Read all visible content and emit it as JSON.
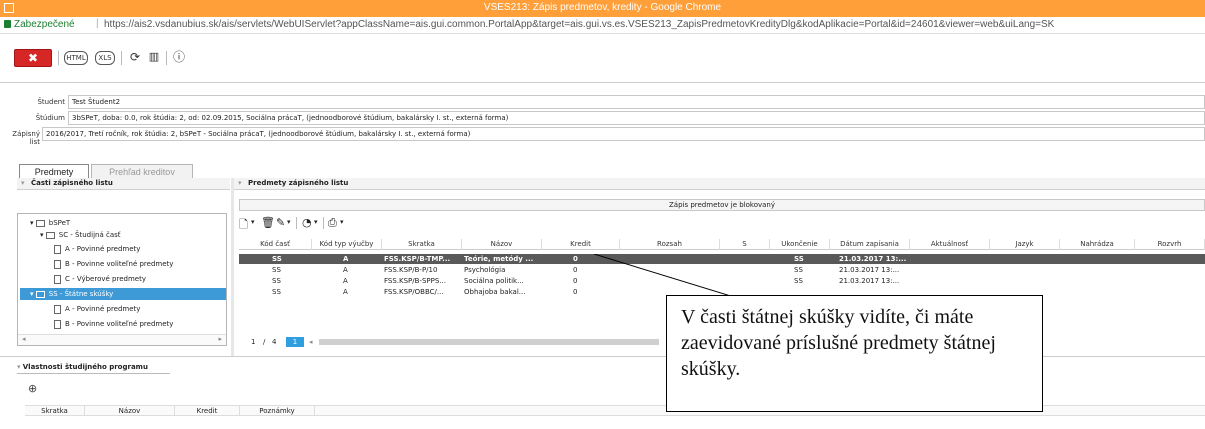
{
  "window": {
    "title": "VSES213: Zápis predmetov, kredity - Google Chrome"
  },
  "address": {
    "secure_label": "Zabezpečené",
    "separator": "|",
    "url": "https://ais2.vsdanubius.sk/ais/servlets/WebUIServlet?appClassName=ais.gui.common.PortalApp&target=ais.gui.vs.es.VSES213_ZapisPredmetovKredityDlg&kodAplikacie=Portal&id=24601&viewer=web&uiLang=SK"
  },
  "toolbar": {
    "close_label": "✖",
    "html_label": "HTML",
    "xls_label": "XLS",
    "info_label": "ⓘ"
  },
  "info": {
    "student_label": "Študent",
    "student_value": "Test Študent2",
    "study_label": "Štúdium",
    "study_value": "3bSPeT, doba: 0.0, rok štúdia: 2, od: 02.09.2015, Sociálna prácaT, (jednoodborové štúdium, bakalársky I. st., externá forma)",
    "enroll_label": "Zápisný list",
    "enroll_value": "2016/2017, Tretí ročník, rok štúdia: 2, bSPeT - Sociálna prácaT, (jednoodborové štúdium, bakalársky I. st., externá forma)"
  },
  "tabs": [
    {
      "label": "Predmety"
    },
    {
      "label": "Prehľad kreditov"
    }
  ],
  "left_panel": {
    "title": "Časti zápisného listu",
    "tree": [
      {
        "label": "bSPeT"
      },
      {
        "label": "SC - Študijná časť"
      },
      {
        "label": "A - Povinné predmety"
      },
      {
        "label": "B - Povinne voliteľné predmety"
      },
      {
        "label": "C - Výberové predmety"
      },
      {
        "label": "SS - Štátne skúšky"
      },
      {
        "label": "A - Povinné predmety"
      },
      {
        "label": "B - Povinne voliteľné predmety"
      }
    ]
  },
  "right_panel": {
    "title": "Predmety zápisného listu",
    "banner": "Zápis predmetov je blokovaný",
    "columns": [
      "Kód časť",
      "Kód typ výučby",
      "Skratka",
      "Názov",
      "Kredit",
      "Rozsah",
      "S",
      "Ukončenie",
      "Dátum zapísania",
      "Aktuálnosť",
      "Jazyk",
      "Nahrádza",
      "Rozvrh"
    ],
    "rows": [
      [
        "SS",
        "A",
        "FSS.KSP/B-TMP...",
        "Teórie, metódy ...",
        "0",
        "",
        "",
        "SS",
        "21.03.2017 13:...",
        "",
        "",
        "",
        ""
      ],
      [
        "SS",
        "A",
        "FSS.KSP/B-P/10",
        "Psychológia",
        "0",
        "",
        "",
        "SS",
        "21.03.2017 13:...",
        "",
        "",
        "",
        ""
      ],
      [
        "SS",
        "A",
        "FSS.KSP/B-SPPS...",
        "Sociálna politik...",
        "0",
        "",
        "",
        "SS",
        "21.03.2017 13:...",
        "",
        "",
        "",
        ""
      ],
      [
        "SS",
        "A",
        "FSS.KSP/OBBC/...",
        "Obhajoba bakal...",
        "0",
        "",
        "",
        "",
        "",
        "",
        "",
        "",
        ""
      ]
    ],
    "pager": {
      "current": "1",
      "sep": "/",
      "total": "4",
      "selected": "1"
    }
  },
  "program": {
    "title": "Vlastnosti študijného programu",
    "columns": [
      "Skratka",
      "Názov",
      "Kredit",
      "Poznámky"
    ]
  },
  "callout": {
    "text": "V časti štátnej skúšky vidíte, či máte zaevidované príslušné predmety štátnej skúšky."
  }
}
